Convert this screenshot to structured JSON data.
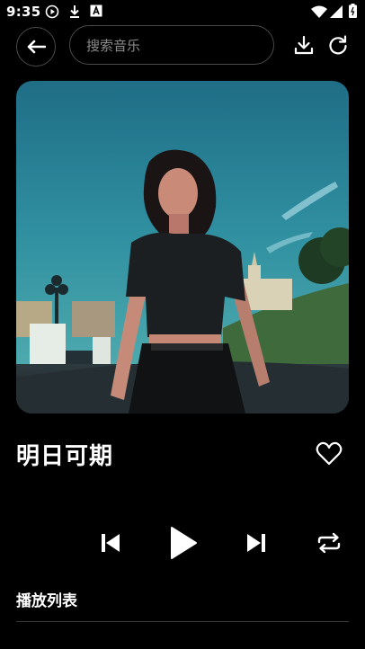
{
  "status_bar": {
    "time": "9:35",
    "icons": [
      "play-circle-icon",
      "download-icon",
      "a-icon",
      "wifi-icon",
      "signal-icon",
      "battery-icon"
    ]
  },
  "top_bar": {
    "search_placeholder": "搜索音乐",
    "icons": [
      "back-arrow-icon",
      "download-icon",
      "refresh-icon"
    ]
  },
  "player": {
    "song_title": "明日可期",
    "favorite_icon": "heart-outline-icon",
    "controls": [
      "skip-previous-icon",
      "play-icon",
      "skip-next-icon",
      "repeat-icon"
    ]
  },
  "playlist": {
    "heading": "播放列表"
  },
  "colors": {
    "background": "#000000",
    "text": "#ffffff",
    "border": "#4a4a4a",
    "placeholder": "#8a8a8a"
  }
}
